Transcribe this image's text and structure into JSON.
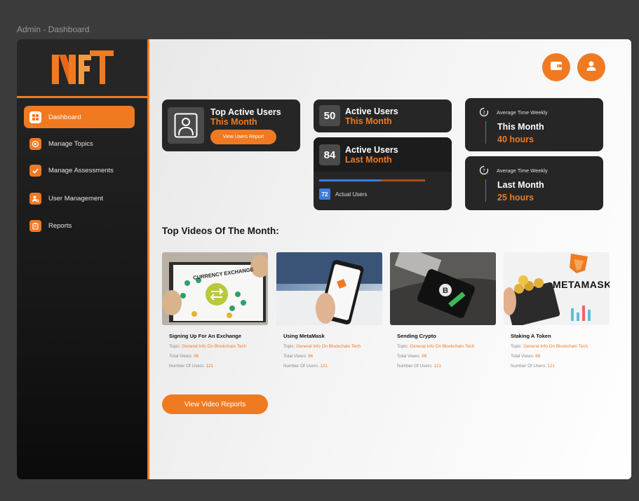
{
  "window": {
    "title": "Admin - Dashboard"
  },
  "logo": {
    "text": "NFT"
  },
  "sidebar": {
    "items": [
      {
        "label": "Dashboard",
        "icon": "grid-icon"
      },
      {
        "label": "Manage Topics",
        "icon": "target-icon"
      },
      {
        "label": "Manage Assessments",
        "icon": "check-icon"
      },
      {
        "label": "User Management",
        "icon": "user-gear-icon"
      },
      {
        "label": "Reports",
        "icon": "clipboard-icon"
      }
    ]
  },
  "header": {
    "wallet_icon": "wallet-icon",
    "profile_icon": "user-icon"
  },
  "cards": {
    "top_active": {
      "title": "Top Active Users",
      "subtitle": "This Month",
      "button": "View Users Report"
    },
    "active_this_month": {
      "count": "50",
      "title": "Active Users",
      "subtitle": "This Month"
    },
    "active_last_month": {
      "count": "84",
      "title": "Active Users",
      "subtitle": "Last Month",
      "actual_count": "72",
      "actual_label": "Actual Users",
      "progress": 0.58
    },
    "avg_this_month": {
      "label": "Average Time Weekly",
      "period": "This Month",
      "value": "40 hours"
    },
    "avg_last_month": {
      "label": "Average Time Weekly",
      "period": "Last Month",
      "value": "25 hours"
    }
  },
  "videos": {
    "section_title": "Top Videos Of The Month:",
    "topic_label": "Topic:",
    "views_label": "Total Views:",
    "users_label": "Number Of Users:",
    "items": [
      {
        "title": "Signing Up For An Exchange",
        "topic": "General Info On Blockchain Tech",
        "views": "86",
        "users": "121",
        "thumb_text": "CURRENCY EXCHANGE"
      },
      {
        "title": "Using MetaMask",
        "topic": "General Info On Blockchain Tech",
        "views": "86",
        "users": "121",
        "thumb_text": ""
      },
      {
        "title": "Sending Crypto",
        "topic": "General Info On Blockchain Tech",
        "views": "86",
        "users": "121",
        "thumb_text": ""
      },
      {
        "title": "Staking A Token",
        "topic": "General Info On Blockchain Tech",
        "views": "86",
        "users": "121",
        "thumb_text": "METAMASK"
      }
    ],
    "button": "View Video Reports"
  },
  "colors": {
    "accent": "#f07a22",
    "dark": "#262626",
    "blue": "#3b7ddd"
  }
}
